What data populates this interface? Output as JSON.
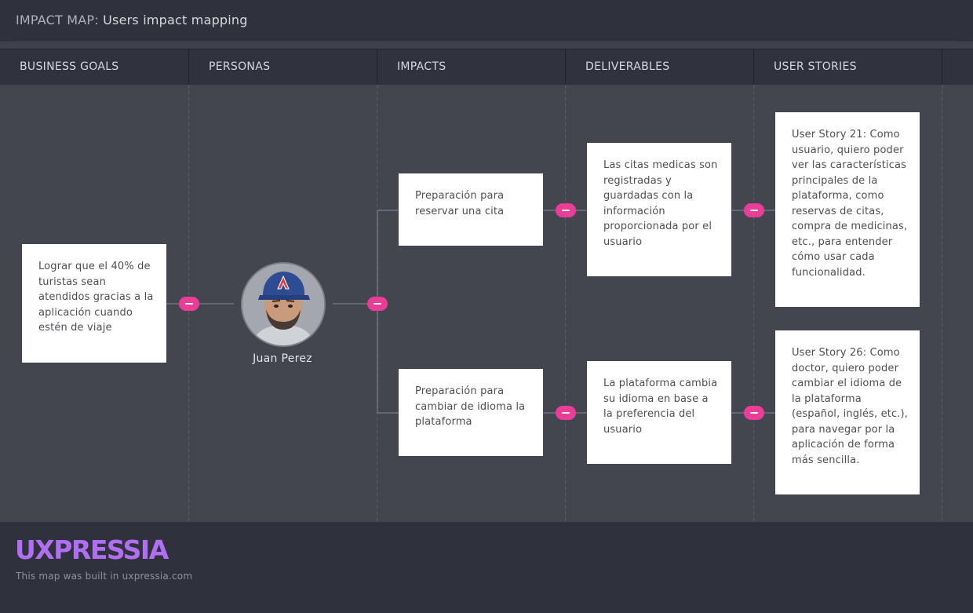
{
  "header": {
    "title_prefix": "IMPACT MAP:",
    "title": "Users impact mapping"
  },
  "columns": [
    {
      "label": "BUSINESS GOALS"
    },
    {
      "label": "PERSONAS"
    },
    {
      "label": "IMPACTS"
    },
    {
      "label": "DELIVERABLES"
    },
    {
      "label": "USER STORIES"
    }
  ],
  "business_goal": {
    "text": "Lograr que el 40% de turistas sean atendidos gracias a la aplicación cuando estén de viaje"
  },
  "persona": {
    "name": "Juan Perez"
  },
  "impacts": [
    {
      "text": "Preparación para reservar una cita"
    },
    {
      "text": "Preparación para cambiar de idioma la plataforma"
    }
  ],
  "deliverables": [
    {
      "text": "Las citas medicas son registradas y guardadas con la información proporcionada por el usuario"
    },
    {
      "text": "La plataforma cambia su idioma en base a la preferencia del usuario"
    }
  ],
  "user_stories": [
    {
      "text": "User Story 21: Como usuario, quiero poder ver las características principales de la plataforma, como reservas de citas, compra de medicinas, etc., para entender cómo usar cada funcionalidad."
    },
    {
      "text": "User Story 26: Como doctor, quiero poder cambiar el idioma de la plataforma (español, inglés, etc.), para navegar por la aplicación de forma más sencilla."
    }
  ],
  "footer": {
    "brand": "UXPRESSIA",
    "note": "This map was built in uxpressia.com"
  },
  "colors": {
    "accent": "#ea3d97",
    "brand": "#b06ef0",
    "board": "#43464f",
    "header": "#30333d"
  }
}
